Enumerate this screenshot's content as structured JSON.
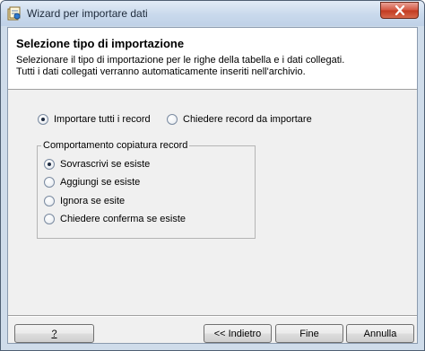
{
  "window": {
    "title": "Wizard per importare dati"
  },
  "header": {
    "title": "Selezione tipo di importazione",
    "desc_line1": "Selezionare il tipo di importazione per le righe della tabella e i dati collegati.",
    "desc_line2": "Tutti i dati collegati verranno automaticamente inseriti nell'archivio."
  },
  "import_mode": {
    "option_all": "Importare tutti i record",
    "option_ask": "Chiedere record da importare",
    "selected": "option_all"
  },
  "copy_behavior": {
    "label": "Comportamento copiatura record",
    "options": [
      "Sovrascrivi se esiste",
      "Aggiungi se esiste",
      "Ignora se esite",
      "Chiedere conferma se esiste"
    ],
    "selected_index": 0
  },
  "buttons": {
    "help": "?",
    "back": "<< Indietro",
    "finish": "Fine",
    "cancel": "Annulla"
  },
  "icons": {
    "title": "wizard-app-icon",
    "close": "close-icon"
  },
  "colors": {
    "close_button": "#c2391f",
    "title_bar": "#c9d9ec",
    "dialog_bg": "#f0f0f0"
  }
}
